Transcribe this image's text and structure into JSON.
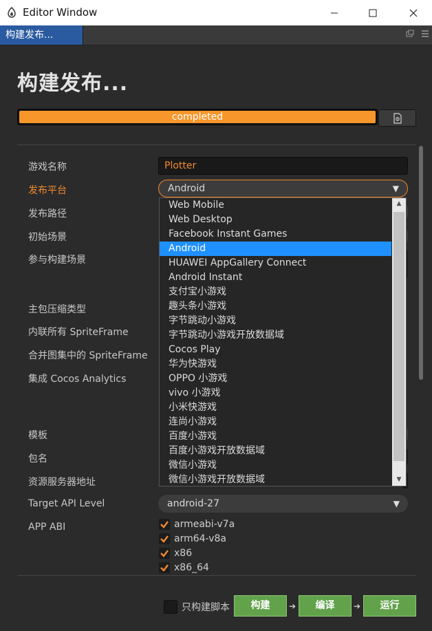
{
  "window": {
    "title": "Editor Window"
  },
  "tab": {
    "label": "构建发布..."
  },
  "panel": {
    "heading": "构建发布...",
    "progress_text": "completed",
    "progress": 1.0
  },
  "fields": {
    "game_name_label": "游戏名称",
    "game_name_value": "Plotter",
    "platform_label": "发布平台",
    "platform_value": "Android",
    "build_path_label": "发布路径",
    "start_scene_label": "初始场景",
    "included_scenes_label": "参与构建场景",
    "compression_label": "主包压缩类型",
    "inline_sprite_label": "内联所有 SpriteFrame",
    "merge_atlas_label": "合并图集中的 SpriteFrame",
    "analytics_label": "集成 Cocos Analytics",
    "template_label": "模板",
    "package_label": "包名",
    "resource_server_label": "资源服务器地址",
    "target_api_label": "Target API Level",
    "target_api_value": "android-27",
    "app_abi_label": "APP ABI"
  },
  "platform_options": [
    "Web Mobile",
    "Web Desktop",
    "Facebook Instant Games",
    "Android",
    "HUAWEI AppGallery Connect",
    "Android Instant",
    "支付宝小游戏",
    "趣头条小游戏",
    "字节跳动小游戏",
    "字节跳动小游戏开放数据域",
    "Cocos Play",
    "华为快游戏",
    "OPPO 小游戏",
    "vivo 小游戏",
    "小米快游戏",
    "连尚小游戏",
    "百度小游戏",
    "百度小游戏开放数据域",
    "微信小游戏",
    "微信小游戏开放数据域"
  ],
  "selected_platform_index": 3,
  "abi_options": [
    {
      "label": "armeabi-v7a",
      "checked": true
    },
    {
      "label": "arm64-v8a",
      "checked": true
    },
    {
      "label": "x86",
      "checked": true
    },
    {
      "label": "x86_64",
      "checked": true
    }
  ],
  "footer": {
    "only_script_label": "只构建脚本",
    "build_label": "构建",
    "compile_label": "编译",
    "run_label": "运行"
  },
  "colors": {
    "accent": "#f28a2e",
    "progress": "#f7962a",
    "selected": "#1e90ff",
    "green_button": "#61a24a",
    "tab": "#2a5aa0"
  },
  "icons": [
    "app-icon",
    "minimize-icon",
    "maximize-icon",
    "close-icon",
    "popout-icon",
    "menu-icon",
    "open-log-icon",
    "chevron-down-icon",
    "checkmark-icon",
    "arrow-right-icon"
  ]
}
